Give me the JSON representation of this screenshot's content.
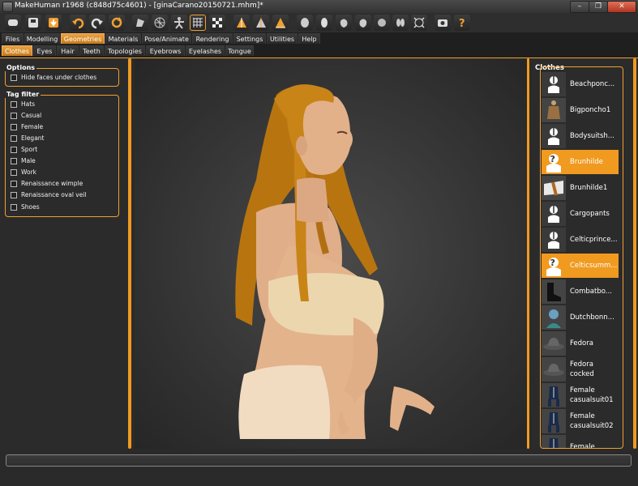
{
  "window": {
    "title": "MakeHuman r1968 (c848d75c4601) - [ginaCarano20150721.mhm]*",
    "minimize": "–",
    "maximize": "❐",
    "close": "✕"
  },
  "toolbar_icons": [
    "undo",
    "redo",
    "reset",
    "smooth",
    "wireframe",
    "background",
    "pose",
    "front",
    "back",
    "side",
    "top",
    "bottom",
    "left",
    "right",
    "grid",
    "screenshot",
    "help"
  ],
  "main_tabs": [
    "Files",
    "Modelling",
    "Geometries",
    "Materials",
    "Pose/Animate",
    "Rendering",
    "Settings",
    "Utilities",
    "Help"
  ],
  "main_tab_active": "Geometries",
  "sub_tabs": [
    "Clothes",
    "Eyes",
    "Hair",
    "Teeth",
    "Topologies",
    "Eyebrows",
    "Eyelashes",
    "Tongue"
  ],
  "sub_tab_active": "Clothes",
  "options": {
    "title": "Options",
    "hide_faces": "Hide faces under clothes"
  },
  "tag_filter": {
    "title": "Tag filter",
    "tags": [
      "Hats",
      "Casual",
      "Female",
      "Elegant",
      "Sport",
      "Male",
      "Work",
      "Renaissance wimple",
      "Renaissance oval veil",
      "Shoes"
    ]
  },
  "clothes": {
    "title": "Clothes",
    "items": [
      {
        "label": "Beachponc...",
        "thumb": "notfound",
        "selected": false
      },
      {
        "label": "Bigponcho1",
        "thumb": "poncho",
        "selected": false
      },
      {
        "label": "Bodysuitsh...",
        "thumb": "notfound",
        "selected": false
      },
      {
        "label": "Brunhilde",
        "thumb": "unknown",
        "selected": true
      },
      {
        "label": "Brunhilde1",
        "thumb": "shape",
        "selected": false
      },
      {
        "label": "Cargopants",
        "thumb": "notfound",
        "selected": false
      },
      {
        "label": "Celticprince...",
        "thumb": "notfound",
        "selected": false
      },
      {
        "label": "Celticsumm...",
        "thumb": "unknown",
        "selected": true
      },
      {
        "label": "Combatbo...",
        "thumb": "boots",
        "selected": false
      },
      {
        "label": "Dutchbonn...",
        "thumb": "bonnet",
        "selected": false
      },
      {
        "label": "Fedora",
        "thumb": "hat",
        "selected": false
      },
      {
        "label": "Fedora\ncocked",
        "thumb": "hat",
        "selected": false
      },
      {
        "label": "Female\ncasualsuit01",
        "thumb": "suit",
        "selected": false
      },
      {
        "label": "Female\ncasualsuit02",
        "thumb": "suit",
        "selected": false
      },
      {
        "label": "Female",
        "thumb": "suit",
        "selected": false
      }
    ]
  },
  "colors": {
    "accent": "#f09a20",
    "panel": "#2b2b2b",
    "hair": "#c98418",
    "skin": "#e2b18a",
    "top": "#e9d2a8",
    "pants": "#f1dcc2"
  }
}
